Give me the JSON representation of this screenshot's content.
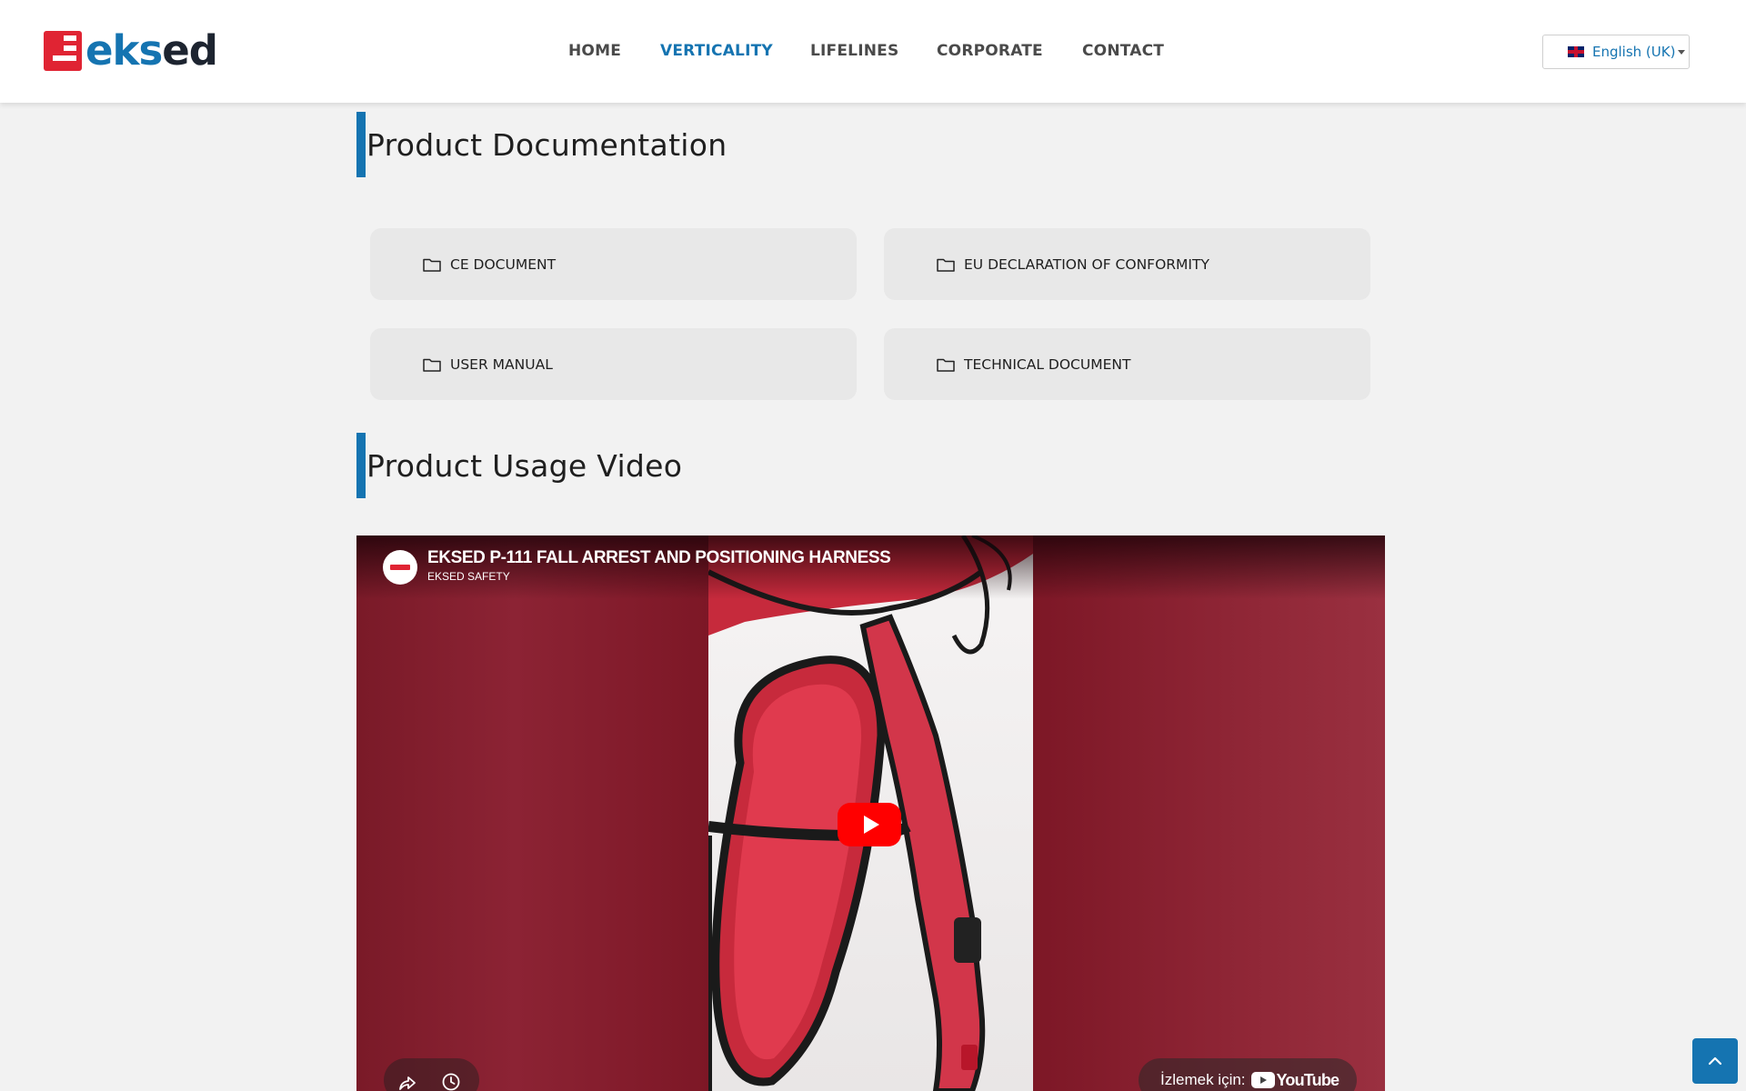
{
  "brand": {
    "logo_parts": [
      "eks",
      "ed"
    ],
    "accent_color": "#1574b1",
    "logo_red": "#e02433"
  },
  "nav": {
    "items": [
      {
        "label": "HOME",
        "active": false
      },
      {
        "label": "VERTICALITY",
        "active": true
      },
      {
        "label": "LIFELINES",
        "active": false
      },
      {
        "label": "CORPORATE",
        "active": false
      },
      {
        "label": "CONTACT",
        "active": false
      }
    ]
  },
  "language": {
    "selected": "English (UK)",
    "flag_icon": "uk-flag-icon"
  },
  "documentation": {
    "title": "Product Documentation",
    "items": [
      {
        "label": "CE DOCUMENT",
        "icon": "folder-icon"
      },
      {
        "label": "EU DECLARATION OF CONFORMITY",
        "icon": "folder-icon"
      },
      {
        "label": "USER MANUAL",
        "icon": "folder-icon"
      },
      {
        "label": "TECHNICAL DOCUMENT",
        "icon": "folder-icon"
      }
    ]
  },
  "video": {
    "section_title": "Product Usage Video",
    "title": "EKSED P-111 FALL ARREST AND POSITIONING HARNESS",
    "channel": "EKSED SAFETY",
    "watch_on_label": "İzlemek için:",
    "youtube_word": "YouTube"
  }
}
